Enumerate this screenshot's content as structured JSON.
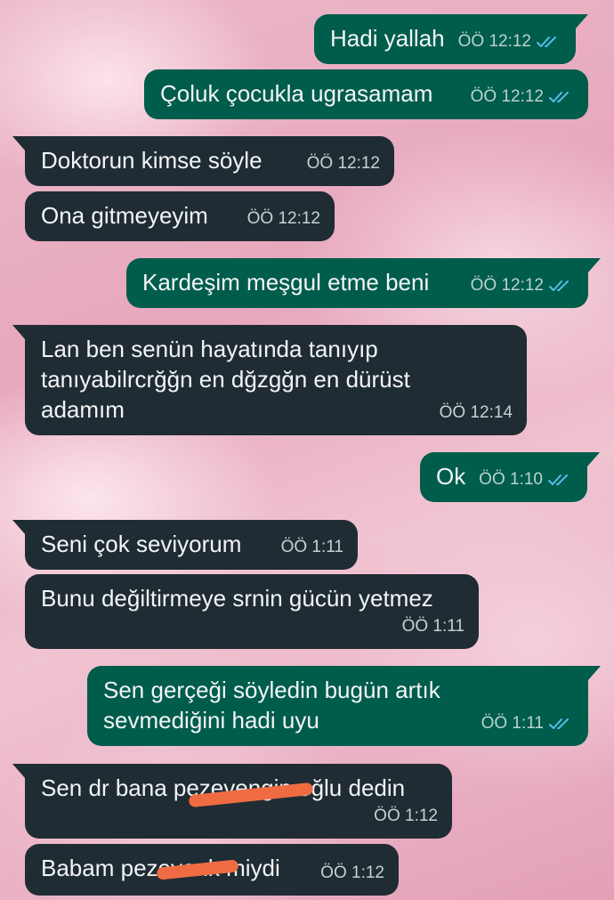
{
  "colors": {
    "outgoing_bubble": "#005c4b",
    "incoming_bubble": "#202c33",
    "read_ticks": "#53bdeb",
    "redaction_scribble": "#ef6c43"
  },
  "messages": [
    {
      "direction": "out",
      "text": "Hadi yallah",
      "time": "ÖÖ 12:12",
      "status_icon": "double-check-read"
    },
    {
      "direction": "out",
      "text": "Çoluk çocukla ugrasamam",
      "time": "ÖÖ 12:12",
      "status_icon": "double-check-read"
    },
    {
      "direction": "in",
      "text": "Doktorun kimse söyle",
      "time": "ÖÖ 12:12"
    },
    {
      "direction": "in",
      "text": "Ona gitmeyeyim",
      "time": "ÖÖ 12:12"
    },
    {
      "direction": "out",
      "text": "Kardeşim meşgul etme beni",
      "time": "ÖÖ 12:12",
      "status_icon": "double-check-read"
    },
    {
      "direction": "in",
      "text": "Lan ben senün hayatında tanıyıp tanıyabilrcrğğn en dğzgğn en dürüst adamım",
      "time": "ÖÖ 12:14"
    },
    {
      "direction": "out",
      "text": "Ok",
      "time": "ÖÖ 1:10",
      "status_icon": "double-check-read"
    },
    {
      "direction": "in",
      "text": "Seni çok seviyorum",
      "time": "ÖÖ 1:11"
    },
    {
      "direction": "in",
      "text": "Bunu değiltirmeye srnin gücün yetmez",
      "time": "ÖÖ 1:11"
    },
    {
      "direction": "out",
      "text": "Sen gerçeği söyledin bugün artık sevmediğini hadi uyu",
      "time": "ÖÖ 1:11",
      "status_icon": "double-check-read"
    },
    {
      "direction": "in",
      "text": "Sen dr bana pezevengin oğlu dedin",
      "time": "ÖÖ 1:12"
    },
    {
      "direction": "in",
      "text": "Babam pezevenk miydi",
      "time": "ÖÖ 1:12"
    }
  ]
}
